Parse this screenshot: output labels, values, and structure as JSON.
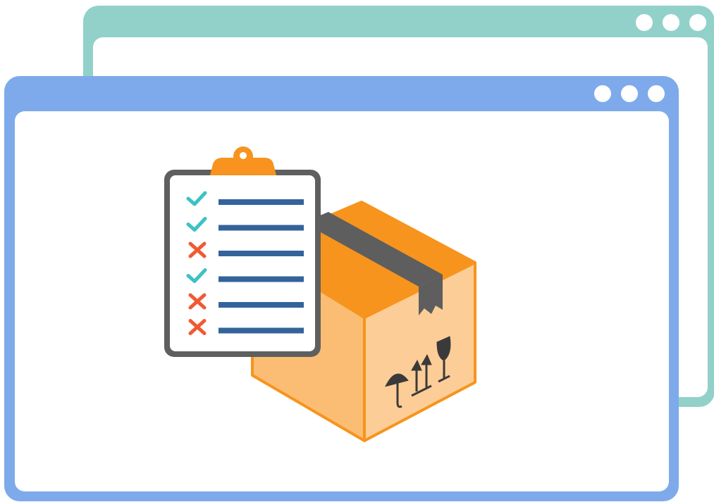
{
  "colors": {
    "back_window": "#92d1ca",
    "front_window": "#7eaaeb",
    "clipboard_frame": "#5f5f5f",
    "clipboard_clip": "#f7931e",
    "check": "#3ec1c4",
    "cross": "#f05a33",
    "line": "#33639a",
    "box_top": "#f7941d",
    "box_side": "#fbbd73",
    "box_front": "#fdcd97",
    "tape": "#5e5e5e"
  },
  "back_window": {
    "icon": "window-icon",
    "dots": [
      "window-dot-icon",
      "window-dot-icon",
      "window-dot-icon"
    ]
  },
  "front_window": {
    "icon": "window-icon",
    "dots": [
      "window-dot-icon",
      "window-dot-icon",
      "window-dot-icon"
    ]
  },
  "checklist": {
    "icon": "clipboard-checklist-icon",
    "items": [
      {
        "status": "checked",
        "icon": "checkmark-icon"
      },
      {
        "status": "checked",
        "icon": "checkmark-icon"
      },
      {
        "status": "failed",
        "icon": "cross-icon"
      },
      {
        "status": "checked",
        "icon": "checkmark-icon"
      },
      {
        "status": "failed",
        "icon": "cross-icon"
      },
      {
        "status": "failed",
        "icon": "cross-icon"
      }
    ]
  },
  "package": {
    "icon": "cardboard-box-icon",
    "handling_symbols": [
      "keep-dry-umbrella-icon",
      "this-way-up-arrows-icon",
      "fragile-glass-icon"
    ]
  }
}
